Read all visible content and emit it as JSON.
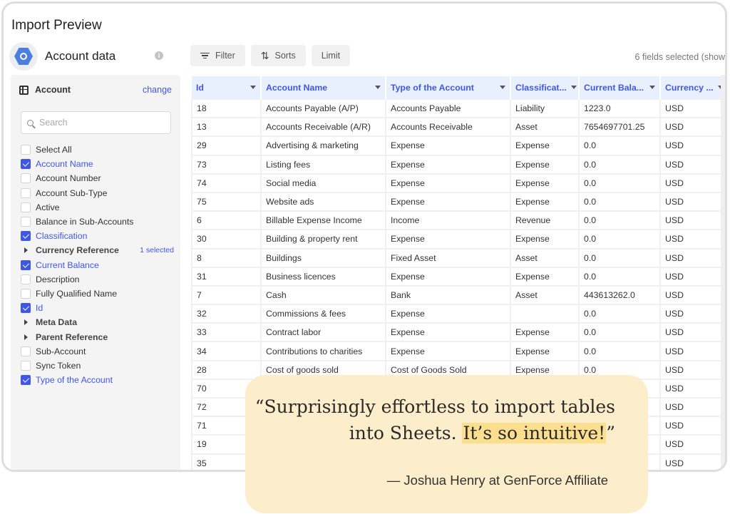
{
  "window": {
    "title": "Import Preview"
  },
  "source": {
    "name": "Account data",
    "logo_icon": "bigquery-hex-icon",
    "info_icon": "info-icon"
  },
  "toolbar": {
    "filter_label": "Filter",
    "sorts_label": "Sorts",
    "limit_label": "Limit",
    "fields_selected": "6 fields selected (show"
  },
  "sidebar": {
    "table_name": "Account",
    "change_label": "change",
    "search_placeholder": "Search",
    "fields": [
      {
        "label": "Select All",
        "type": "checkbox",
        "checked": false
      },
      {
        "label": "Account Name",
        "type": "checkbox",
        "checked": true
      },
      {
        "label": "Account Number",
        "type": "checkbox",
        "checked": false
      },
      {
        "label": "Account Sub-Type",
        "type": "checkbox",
        "checked": false
      },
      {
        "label": "Active",
        "type": "checkbox",
        "checked": false
      },
      {
        "label": "Balance in Sub-Accounts",
        "type": "checkbox",
        "checked": false
      },
      {
        "label": "Classification",
        "type": "checkbox",
        "checked": true
      },
      {
        "label": "Currency Reference",
        "type": "group",
        "selected": "1 selected"
      },
      {
        "label": "Current Balance",
        "type": "checkbox",
        "checked": true
      },
      {
        "label": "Description",
        "type": "checkbox",
        "checked": false
      },
      {
        "label": "Fully Qualified Name",
        "type": "checkbox",
        "checked": false
      },
      {
        "label": "Id",
        "type": "checkbox",
        "checked": true
      },
      {
        "label": "Meta Data",
        "type": "group",
        "selected": ""
      },
      {
        "label": "Parent Reference",
        "type": "group",
        "selected": ""
      },
      {
        "label": "Sub-Account",
        "type": "checkbox",
        "checked": false
      },
      {
        "label": "Sync Token",
        "type": "checkbox",
        "checked": false
      },
      {
        "label": "Type of the Account",
        "type": "checkbox",
        "checked": true
      }
    ]
  },
  "table": {
    "columns": [
      "Id",
      "Account Name",
      "Type of the Account",
      "Classificat...",
      "Current Bala...",
      "Currency ..."
    ],
    "rows": [
      [
        "18",
        "Accounts Payable (A/P)",
        "Accounts Payable",
        "Liability",
        "1223.0",
        "USD"
      ],
      [
        "13",
        "Accounts Receivable (A/R)",
        "Accounts Receivable",
        "Asset",
        "7654697701.25",
        "USD"
      ],
      [
        "29",
        "Advertising & marketing",
        "Expense",
        "Expense",
        "0.0",
        "USD"
      ],
      [
        "73",
        "Listing fees",
        "Expense",
        "Expense",
        "0.0",
        "USD"
      ],
      [
        "74",
        "Social media",
        "Expense",
        "Expense",
        "0.0",
        "USD"
      ],
      [
        "75",
        "Website ads",
        "Expense",
        "Expense",
        "0.0",
        "USD"
      ],
      [
        "6",
        "Billable Expense Income",
        "Income",
        "Revenue",
        "0.0",
        "USD"
      ],
      [
        "30",
        "Building & property rent",
        "Expense",
        "Expense",
        "0.0",
        "USD"
      ],
      [
        "8",
        "Buildings",
        "Fixed Asset",
        "Asset",
        "0.0",
        "USD"
      ],
      [
        "31",
        "Business licences",
        "Expense",
        "Expense",
        "0.0",
        "USD"
      ],
      [
        "7",
        "Cash",
        "Bank",
        "Asset",
        "443613262.0",
        "USD"
      ],
      [
        "32",
        "Commissions & fees",
        "Expense",
        "",
        "0.0",
        "USD"
      ],
      [
        "33",
        "Contract labor",
        "Expense",
        "Expense",
        "0.0",
        "USD"
      ],
      [
        "34",
        "Contributions to charities",
        "Expense",
        "Expense",
        "0.0",
        "USD"
      ],
      [
        "28",
        "Cost of goods sold",
        "Cost of Goods Sold",
        "Expense",
        "0.0",
        "USD"
      ],
      [
        "70",
        "",
        "",
        "",
        "",
        "USD"
      ],
      [
        "72",
        "",
        "",
        "",
        "",
        "USD"
      ],
      [
        "71",
        "",
        "",
        "",
        "",
        "USD"
      ],
      [
        "19",
        "",
        "",
        "",
        "",
        "USD"
      ],
      [
        "35",
        "",
        "",
        "",
        "",
        "USD"
      ]
    ]
  },
  "testimonial": {
    "quote_start": "“Surprisingly effortless to import tables",
    "quote_mid": "into Sheets. ",
    "quote_highlight": "It’s so intuitive!",
    "quote_end": "”",
    "attribution": "— Joshua Henry at GenForce Affiliate",
    "highlight_color": "#fbdf8f",
    "card_color": "#fdeecb"
  },
  "theme": {
    "accent": "#3f57e6",
    "header_bg": "#e8f0fe"
  }
}
